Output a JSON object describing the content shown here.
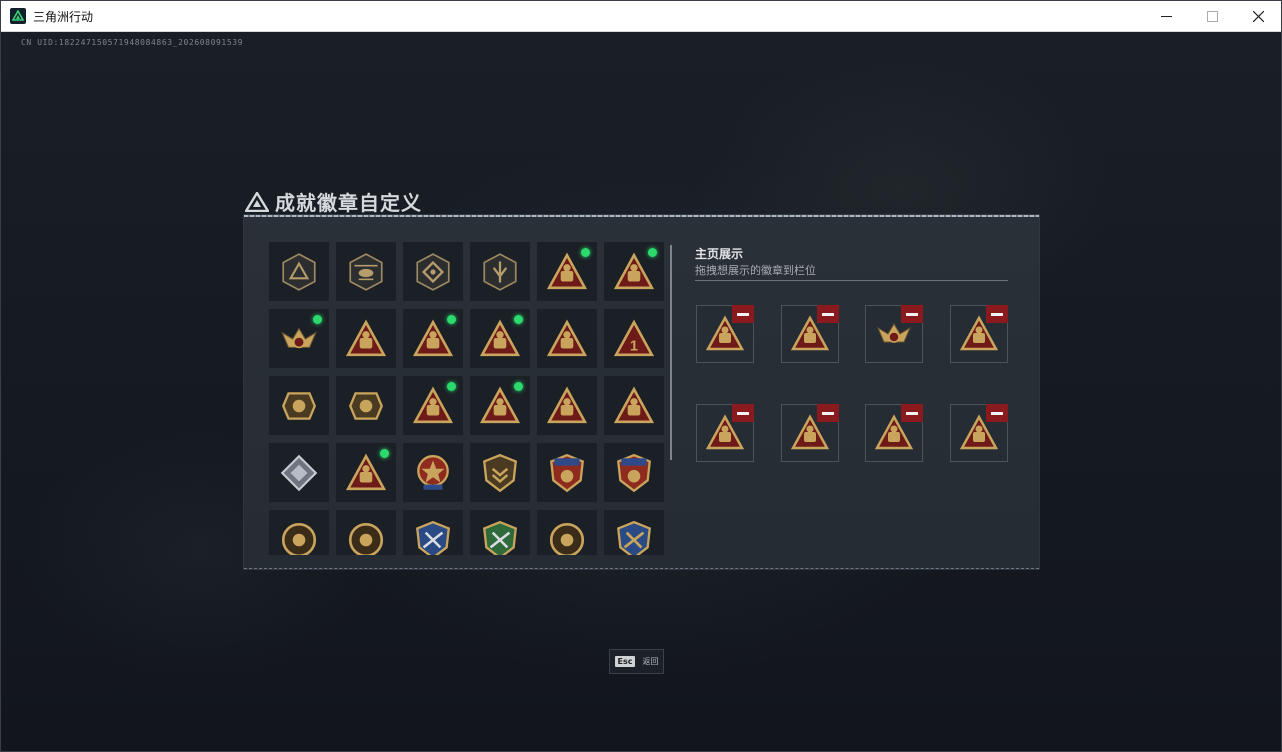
{
  "window": {
    "title": "三角洲行动",
    "controls": [
      "minimize-icon",
      "maximize-icon",
      "close-icon"
    ]
  },
  "uid_text": "CN UID:182247150571948084863_202608091539",
  "page": {
    "title": "成就徽章自定义"
  },
  "badge_grid": {
    "rows": [
      [
        {
          "icon": "triangle-emblem-badge",
          "new": false
        },
        {
          "icon": "helicopter-badge",
          "new": false
        },
        {
          "icon": "diamond-emblem-badge",
          "new": false
        },
        {
          "icon": "shield-arrow-badge",
          "new": false
        },
        {
          "icon": "truck-triangle-badge",
          "new": true
        },
        {
          "icon": "soldier-triangle-badge",
          "new": true
        }
      ],
      [
        {
          "icon": "eagle-crest-badge",
          "new": true
        },
        {
          "icon": "hand-sign-badge",
          "new": false
        },
        {
          "icon": "vehicle-triangle-badge",
          "new": true
        },
        {
          "icon": "operator-triangle-badge",
          "new": true
        },
        {
          "icon": "helmet-triangle-badge",
          "new": false
        },
        {
          "icon": "number-one-badge",
          "new": false
        }
      ],
      [
        {
          "icon": "ring-emblem-badge",
          "new": false
        },
        {
          "icon": "ring-emblem-badge-2",
          "new": false
        },
        {
          "icon": "crate-triangle-badge",
          "new": true
        },
        {
          "icon": "bottle-triangle-badge",
          "new": true
        },
        {
          "icon": "squad-triangle-badge",
          "new": false
        },
        {
          "icon": "rocket-triangle-badge",
          "new": false
        }
      ],
      [
        {
          "icon": "crystal-diamond-badge",
          "new": false
        },
        {
          "icon": "backpack-triangle-badge",
          "new": true
        },
        {
          "icon": "star-medal-badge",
          "new": false
        },
        {
          "icon": "chevron-shield-badge",
          "new": false
        },
        {
          "icon": "stars-shield-badge",
          "new": false
        },
        {
          "icon": "stars-shield-badge-2",
          "new": false
        }
      ],
      [
        {
          "icon": "skull-round-badge",
          "new": false
        },
        {
          "icon": "mask-round-badge",
          "new": false
        },
        {
          "icon": "blue-weapon-shield-badge",
          "new": false
        },
        {
          "icon": "green-weapon-shield-badge",
          "new": false
        },
        {
          "icon": "circle-slash-badge",
          "new": false
        },
        {
          "icon": "gold-weapon-shield-badge",
          "new": false
        }
      ]
    ]
  },
  "showcase": {
    "title": "主页展示",
    "subtitle": "拖拽想展示的徽章到栏位",
    "slots": [
      {
        "icon": "truck-triangle-badge"
      },
      {
        "icon": "soldier-triangle-badge"
      },
      {
        "icon": "eagle-crest-badge"
      },
      {
        "icon": "vehicle-triangle-badge"
      },
      {
        "icon": "operator-triangle-badge"
      },
      {
        "icon": "crate-triangle-badge"
      },
      {
        "icon": "bottle-triangle-badge"
      },
      {
        "icon": "backpack-triangle-badge"
      }
    ]
  },
  "footer": {
    "esc_key": "Esc",
    "back_label": "返回"
  },
  "colors": {
    "gold": "#c9a45c",
    "maroon": "#6e1a18",
    "new_dot": "#2bd96c",
    "remove": "#8b1a1f"
  }
}
